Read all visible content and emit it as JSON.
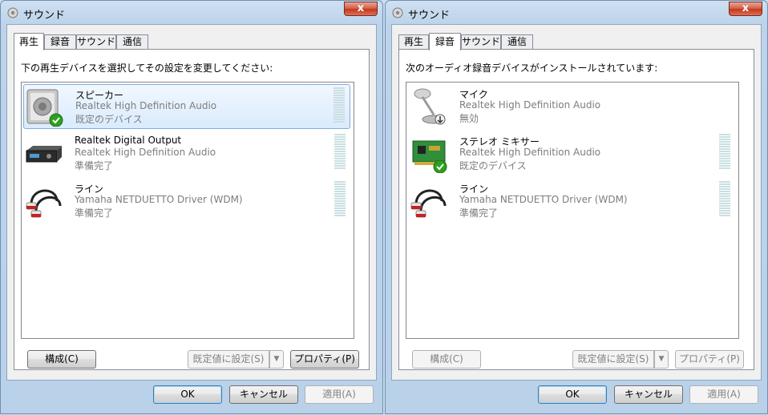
{
  "left": {
    "title": "サウンド",
    "close": "x",
    "tabs": [
      "再生",
      "録音",
      "サウンド",
      "通信"
    ],
    "instruction": "下の再生デバイスを選択してその設定を変更してください:",
    "devices": [
      {
        "name": "スピーカー",
        "driver": "Realtek High Definition Audio",
        "status": "既定のデバイス",
        "icon": "speaker-icon"
      },
      {
        "name": "Realtek Digital Output",
        "driver": "Realtek High Definition Audio",
        "status": "準備完了",
        "icon": "digital-output-icon"
      },
      {
        "name": "ライン",
        "driver": "Yamaha NETDUETTO Driver (WDM)",
        "status": "準備完了",
        "icon": "rca-cable-icon"
      }
    ],
    "configure": "構成(C)",
    "set_default": "既定値に設定(S)",
    "properties": "プロパティ(P)",
    "ok": "OK",
    "cancel": "キャンセル",
    "apply": "適用(A)"
  },
  "right": {
    "title": "サウンド",
    "close": "x",
    "tabs": [
      "再生",
      "録音",
      "サウンド",
      "通信"
    ],
    "instruction": "次のオーディオ録音デバイスがインストールされています:",
    "devices": [
      {
        "name": "マイク",
        "driver": "Realtek High Definition Audio",
        "status": "無効",
        "icon": "microphone-icon"
      },
      {
        "name": "ステレオ ミキサー",
        "driver": "Realtek High Definition Audio",
        "status": "既定のデバイス",
        "icon": "sound-card-icon"
      },
      {
        "name": "ライン",
        "driver": "Yamaha NETDUETTO Driver (WDM)",
        "status": "準備完了",
        "icon": "rca-cable-icon"
      }
    ],
    "configure": "構成(C)",
    "set_default": "既定値に設定(S)",
    "properties": "プロパティ(P)",
    "ok": "OK",
    "cancel": "キャンセル",
    "apply": "適用(A)"
  },
  "colors": {
    "selection": "#d9ebfd",
    "secondary_text": "#7d7d7d",
    "close_button": "#c3381c",
    "default_check": "#2da01e"
  }
}
